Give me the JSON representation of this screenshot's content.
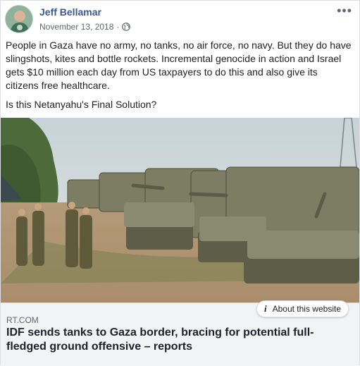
{
  "post": {
    "author": "Jeff Bellamar",
    "date": "November 13, 2018",
    "separator": "·",
    "privacy_icon": "globe-icon",
    "more_icon": "more-options-icon",
    "paragraphs": [
      "People in Gaza have no army, no tanks, no air force, no navy. But they do have slingshots, kites and bottle rockets. Incremental genocide in action and Israel gets $10 million each day from US taxpayers to do this and also give its citizens free healthcare.",
      "Is this Netanyahu's Final Solution?"
    ]
  },
  "link_preview": {
    "image_description": "Israeli soldiers standing beside a row of tanks",
    "about_label": "About this website",
    "about_icon": "info-icon",
    "domain": "RT.COM",
    "title": "IDF sends tanks to Gaza border, bracing for potential full-fledged ground offensive – reports"
  },
  "colors": {
    "author": "#385898",
    "link_bg": "#f2f3f5",
    "secondary_text": "#606770"
  }
}
